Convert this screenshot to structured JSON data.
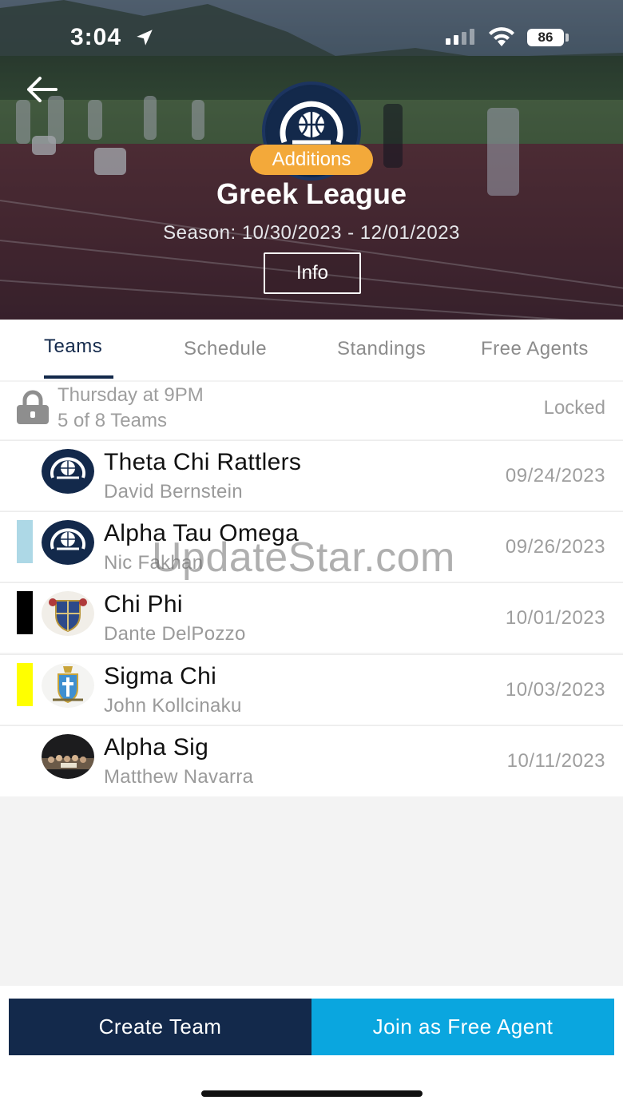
{
  "status_bar": {
    "time": "3:04",
    "battery": "86"
  },
  "hero": {
    "badge": "Additions",
    "title": "Greek League",
    "season": "Season: 10/30/2023 - 12/01/2023",
    "info_button": "Info"
  },
  "tabs": [
    {
      "label": "Teams",
      "active": true
    },
    {
      "label": "Schedule",
      "active": false
    },
    {
      "label": "Standings",
      "active": false
    },
    {
      "label": "Free Agents",
      "active": false
    }
  ],
  "group": {
    "title": "Thursday at 9PM",
    "subtitle": "5 of 8 Teams",
    "status": "Locked"
  },
  "teams": [
    {
      "name": "Theta Chi Rattlers",
      "captain": "David Bernstein",
      "date": "09/24/2023",
      "color": "",
      "avatar": "league-logo"
    },
    {
      "name": "Alpha Tau Omega",
      "captain": "Nic Fakhan",
      "date": "09/26/2023",
      "color": "#add8e6",
      "avatar": "league-logo"
    },
    {
      "name": "Chi Phi",
      "captain": "Dante DelPozzo",
      "date": "10/01/2023",
      "color": "#000000",
      "avatar": "crest"
    },
    {
      "name": "Sigma Chi",
      "captain": "John Kollcinaku",
      "date": "10/03/2023",
      "color": "#ffff00",
      "avatar": "cross-crest"
    },
    {
      "name": "Alpha Sig",
      "captain": "Matthew Navarra",
      "date": "10/11/2023",
      "color": "",
      "avatar": "group-photo"
    }
  ],
  "watermark": "UpdateStar.com",
  "actions": {
    "create_team": "Create Team",
    "join_free_agent": "Join as Free Agent"
  },
  "colors": {
    "navy": "#13294b",
    "accent_blue": "#0aa6df",
    "badge_orange": "#f3a93a"
  }
}
